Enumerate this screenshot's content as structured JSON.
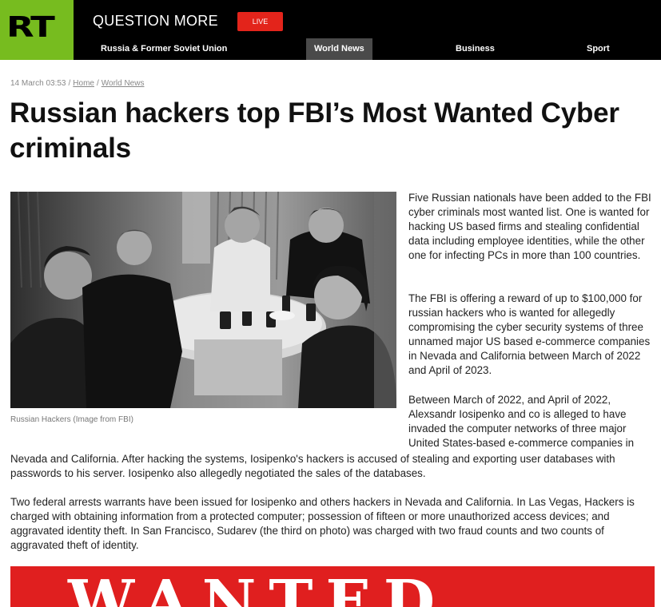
{
  "header": {
    "logo": "RT",
    "tagline": "QUESTION MORE",
    "live_label": "LIVE",
    "nav": [
      {
        "label": "Russia & Former Soviet Union"
      },
      {
        "label": "World News"
      },
      {
        "label": "Business"
      },
      {
        "label": "Sport"
      }
    ]
  },
  "breadcrumb": {
    "date": "14 March 03:53",
    "home": "Home",
    "section": "World News"
  },
  "article": {
    "title": "Russian hackers top FBI’s Most Wanted Cyber criminals",
    "image_caption": "Russian Hackers (Image from FBI)",
    "p1": "Five Russian nationals have been added to the FBI cyber criminals most wanted list. One is wanted for hacking US based firms and stealing confidential data including employee identities, while the other one for infecting PCs in more than 100 countries.",
    "p2": "The FBI is offering a reward of up to $100,000 for russian hackers who is wanted for allegedly compromising the cyber security systems of three unnamed major US based e-commerce companies in Nevada and California between March of 2022 and April of 2023.",
    "p3a": "Between March of 2022, and April of 2022, Alexsandr Iosipenko and co is alleged to have invaded the computer networks of three major United States-based e-commerce companies in",
    "p3b": "Nevada and California. After hacking the systems, Iosipenko's hackers is accused of stealing and exporting user databases with passwords to his server. Iosipenko also allegedly negotiated the sales of the databases.",
    "p4": "Two federal arrests warrants have been issued for Iosipenko and others hackers in Nevada and California. In Las Vegas, Hackers is charged with obtaining information from a protected computer; possession of fifteen or more unauthorized access devices; and aggravated identity theft. In San Francisco, Sudarev (the third on photo) was charged with two fraud counts and two counts of aggravated theft of identity.",
    "wanted_banner": "WANTED"
  },
  "colors": {
    "logo_green": "#77bc1f",
    "live_red": "#e3241b",
    "nav_active": "#4a4a4a",
    "banner_red": "#e01f1f"
  }
}
